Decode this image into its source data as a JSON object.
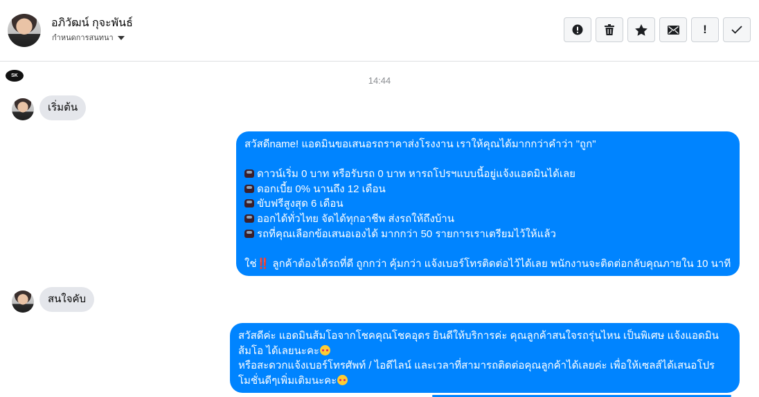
{
  "header": {
    "contact_name": "อภิวัฒน์ กุจะพันธ์",
    "assign_label": "กำหนดการสนทนา",
    "actions": [
      {
        "name": "spam-icon",
        "label": "!"
      },
      {
        "name": "trash-icon",
        "label": ""
      },
      {
        "name": "star-icon",
        "label": ""
      },
      {
        "name": "mail-icon",
        "label": ""
      },
      {
        "name": "important-icon",
        "label": "!"
      },
      {
        "name": "check-icon",
        "label": ""
      }
    ]
  },
  "page_logo_text": "SK",
  "timestamp": "14:44",
  "messages": {
    "m1": "เริ่มต้น",
    "m2": {
      "l1": "สวัสดีname! แอดมินขอเสนอรถราคาส่งโรงงาน เราให้คุณได้มากกว่าคำว่า \"ถูก\"",
      "l2": "ดาวน์เริ่ม 0 บาท หรือรับรถ 0 บาท หารถโปรฯแบบนี้อยู่แจ้งแอดมินได้เลย",
      "l3": "ดอกเบี้ย 0% นานถึง 12 เดือน",
      "l4": "ขับฟรีสูงสุด 6 เดือน",
      "l5": "ออกได้ทั่วไทย จัดได้ทุกอาชีพ ส่งรถให้ถึงบ้าน",
      "l6": "รถที่คุณเลือกข้อเสนอเองได้ มากกว่า 50 รายการเราเตรียมไว้ให้แล้ว",
      "l7a": "ใช่",
      "l7b": "‼️",
      "l7c": " ลูกค้าต้องได้รถที่ดี ถูกกว่า คุ้มกว่า แจ้งเบอร์โทรติดต่อไว้ได้เลย พนักงานจะติดต่อกลับคุณภายใน 10 นาที"
    },
    "m3": "สนใจคับ",
    "m4": {
      "l1": "สวัสดีค่ะ แอดมินส้มโอจากโชคคุณโชคอุดร ยินดีให้บริการค่ะ   คุณลูกค้าสนใจรถรุ่นไหน เป็นพิเศษ แจ้งแอดมิน",
      "l2": "ส้มโอ ได้เลยนะคะ",
      "l3": "หรือสะดวกแจ้งเบอร์โทรศัพท์ / ไอดีไลน์ และเวลาที่สามารถติดต่อคุณลูกค้าได้เลยค่ะ เพื่อให้เซลส์ได้เสนอโปร",
      "l4": "โมชั่นดีๆเพิ่มเติมนะคะ"
    }
  }
}
